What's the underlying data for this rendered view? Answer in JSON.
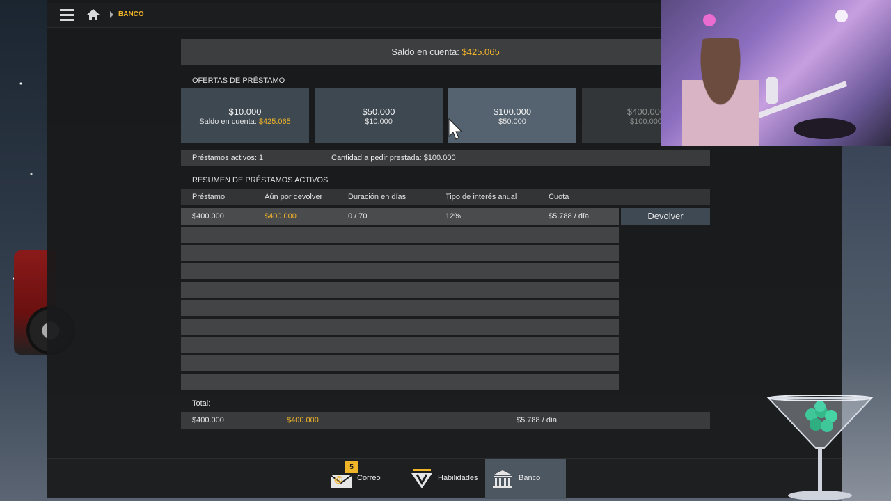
{
  "breadcrumb": {
    "current": "BANCO"
  },
  "balance": {
    "label": "Saldo en cuenta:",
    "value": "$425.065"
  },
  "offers_title": "OFERTAS DE PRÉSTAMO",
  "offers": [
    {
      "amount": "$10.000",
      "sub_label": "Saldo en cuenta:",
      "sub_value": "$425.065"
    },
    {
      "amount": "$50.000",
      "sub_label": "",
      "sub_value": "$10.000"
    },
    {
      "amount": "$100.000",
      "sub_label": "",
      "sub_value": "$50.000"
    },
    {
      "amount": "$400.000",
      "sub_label": "",
      "sub_value": "$100.000"
    }
  ],
  "info": {
    "active_loans": "Préstamos activos: 1",
    "amount_to_borrow": "Cantidad a pedir prestada: $100.000"
  },
  "summary_title": "RESUMEN DE PRÉSTAMOS ACTIVOS",
  "table": {
    "headers": [
      "Préstamo",
      "Aún por devolver",
      "Duración en días",
      "Tipo de interés anual",
      "Cuota"
    ],
    "row": {
      "loan": "$400.000",
      "remaining": "$400.000",
      "duration": "0 / 70",
      "rate": "12%",
      "installment": "$5.788 / día"
    },
    "repay_label": "Devolver"
  },
  "totals": {
    "label": "Total:",
    "loan": "$400.000",
    "remaining": "$400.000",
    "installment": "$5.788 / día"
  },
  "nav": {
    "mail_label": "Correo",
    "mail_badge": "5",
    "skills_label": "Habilidades",
    "bank_label": "Banco"
  },
  "colors": {
    "accent": "#f0b429",
    "selected_tab": "#4c5762"
  }
}
